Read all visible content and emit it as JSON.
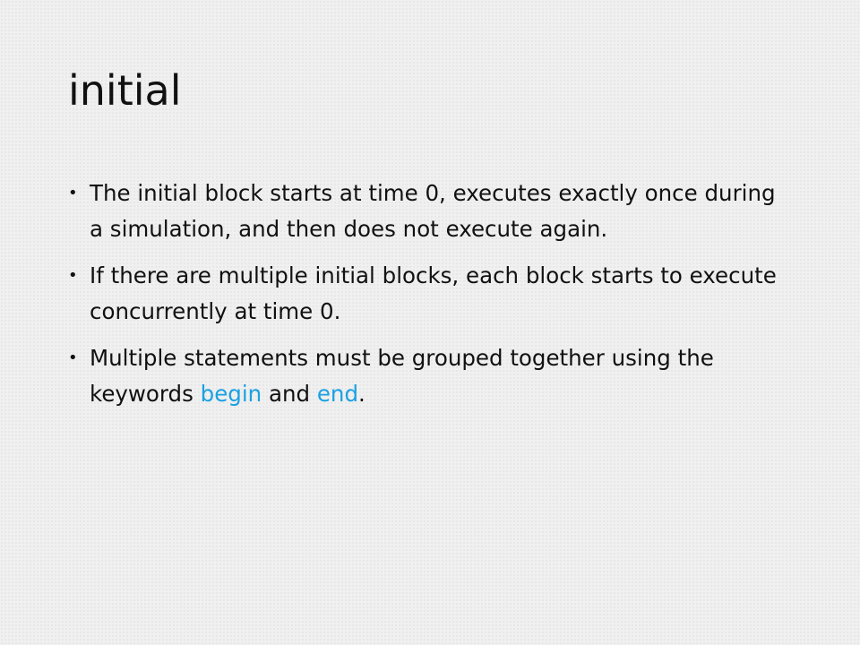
{
  "slide": {
    "title": "initial",
    "bullets": [
      {
        "text": "The initial block starts at time 0, executes exactly once during a simulation, and then does not execute again."
      },
      {
        "text": "If there are multiple initial blocks, each block starts to execute concurrently at time 0."
      },
      {
        "prefix": "Multiple statements must be grouped together using the keywords ",
        "keyword1": "begin",
        "middle": " and ",
        "keyword2": "end",
        "suffix": "."
      }
    ],
    "bullet_glyph": "•",
    "keyword_color": "#1ba1e2"
  }
}
